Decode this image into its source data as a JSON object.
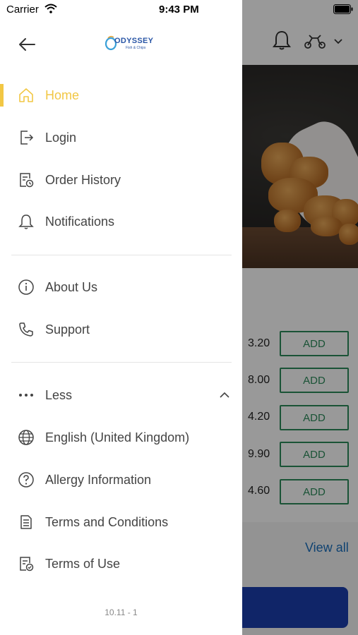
{
  "status_bar": {
    "carrier": "Carrier",
    "time": "9:43 PM"
  },
  "drawer": {
    "logo_text": "ODYSSEY",
    "logo_subtext": "Fish & Chips",
    "menu_primary": [
      {
        "label": "Home",
        "icon": "home-icon",
        "active": true
      },
      {
        "label": "Login",
        "icon": "login-icon",
        "active": false
      },
      {
        "label": "Order History",
        "icon": "order-history-icon",
        "active": false
      },
      {
        "label": "Notifications",
        "icon": "bell-icon",
        "active": false
      }
    ],
    "menu_secondary": [
      {
        "label": "About Us",
        "icon": "info-icon"
      },
      {
        "label": "Support",
        "icon": "phone-icon"
      }
    ],
    "less_label": "Less",
    "menu_more": [
      {
        "label": "English (United Kingdom)",
        "icon": "globe-icon"
      },
      {
        "label": "Allergy Information",
        "icon": "question-icon"
      },
      {
        "label": "Terms and Conditions",
        "icon": "document-icon"
      },
      {
        "label": "Terms of Use",
        "icon": "document-check-icon"
      }
    ],
    "version": "10.11 - 1"
  },
  "background": {
    "prices": [
      "3.20",
      "8.00",
      "4.20",
      "9.90",
      "4.60"
    ],
    "add_label": "ADD",
    "view_all": "View all"
  },
  "colors": {
    "accent": "#f2c744",
    "add_green": "#2c8a5a",
    "link_blue": "#1a6fbd",
    "button_blue": "#1c3fae"
  }
}
